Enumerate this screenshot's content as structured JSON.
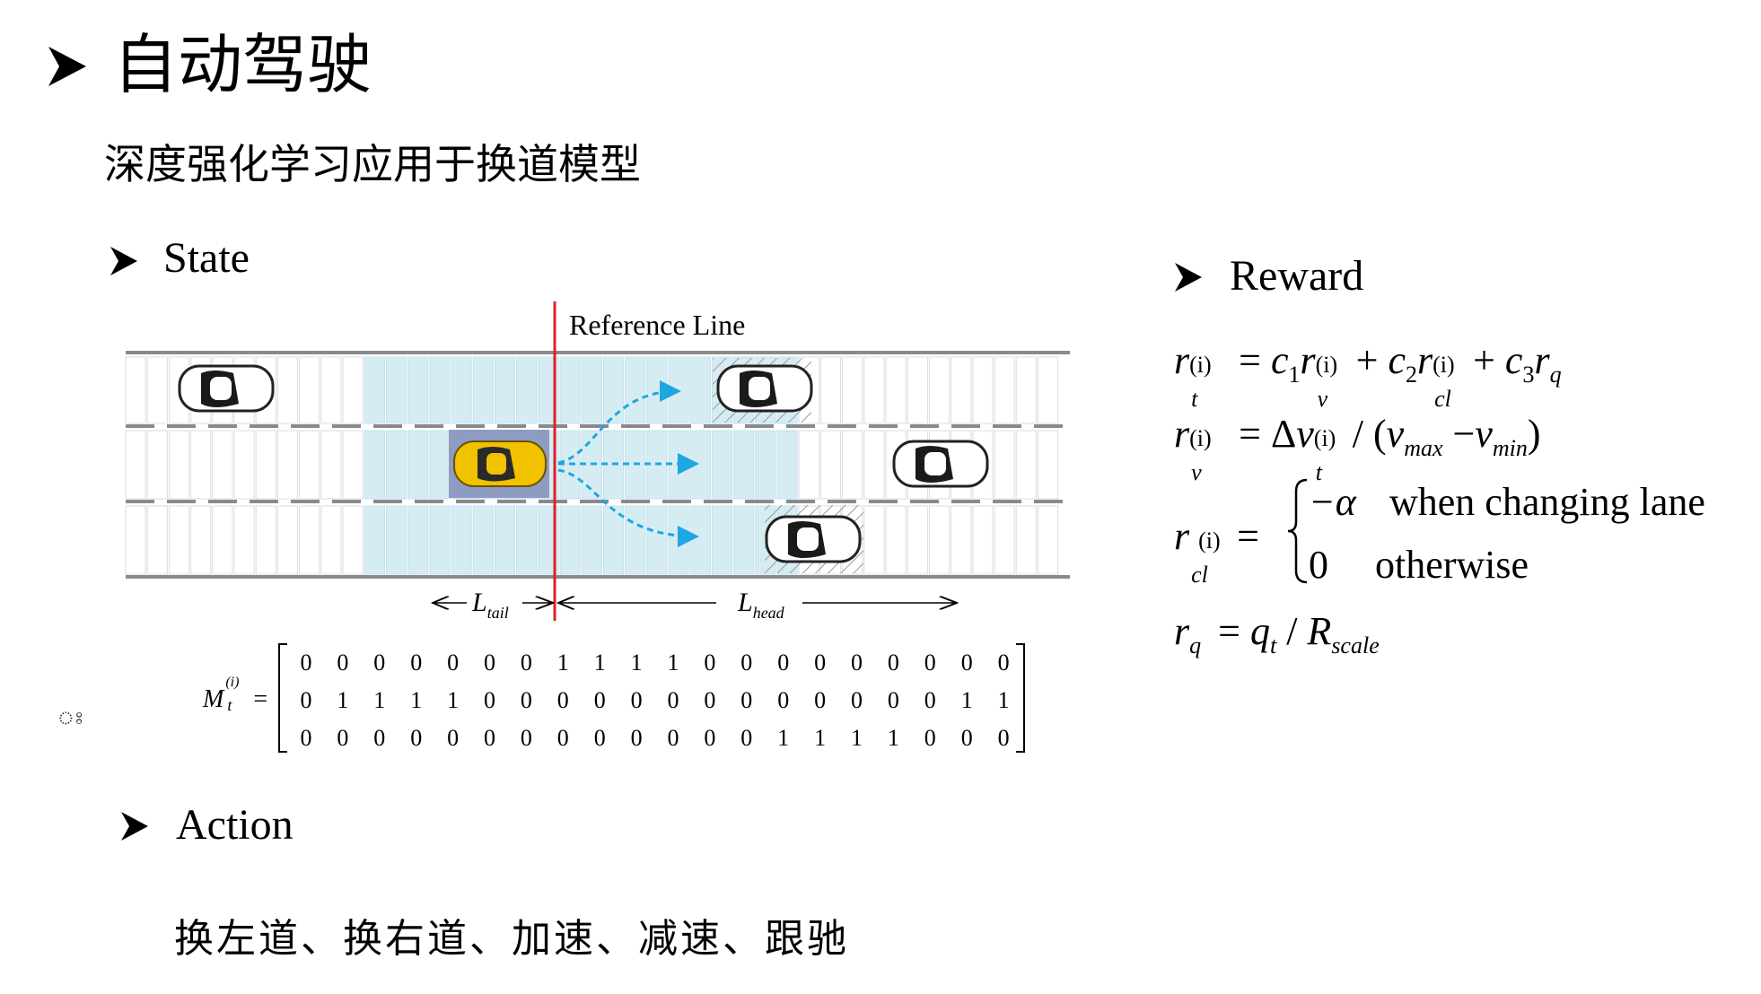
{
  "slide": {
    "title": "自动驾驶",
    "subtitle": "深度强化学习应用于换道模型"
  },
  "sections": {
    "state": "State",
    "reward": "Reward",
    "action": "Action"
  },
  "action_text": "换左道、换右道、加速、减速、跟驰",
  "figure": {
    "reference_line_label": "Reference Line",
    "l_tail": {
      "base": "L",
      "sub": "tail"
    },
    "l_head": {
      "base": "L",
      "sub": "head"
    },
    "ego_color": "#f2c200",
    "highlight_color": "#d6ecf3",
    "reference_color": "#e0202a",
    "arrow_color": "#1ea7e1"
  },
  "matrix": {
    "symbol": "M",
    "sub": "t",
    "sup": "(i)",
    "equals": "=",
    "rows": [
      [
        "0",
        "0",
        "0",
        "0",
        "0",
        "0",
        "0",
        "1",
        "1",
        "1",
        "1",
        "0",
        "0",
        "0",
        "0",
        "0",
        "0",
        "0",
        "0",
        "0"
      ],
      [
        "0",
        "1",
        "1",
        "1",
        "1",
        "0",
        "0",
        "0",
        "0",
        "0",
        "0",
        "0",
        "0",
        "0",
        "0",
        "0",
        "0",
        "0",
        "1",
        "1"
      ],
      [
        "0",
        "0",
        "0",
        "0",
        "0",
        "0",
        "0",
        "0",
        "0",
        "0",
        "0",
        "0",
        "0",
        "1",
        "1",
        "1",
        "1",
        "0",
        "0",
        "0"
      ]
    ]
  },
  "stray_mark": "ঃ",
  "reward_formulas": {
    "f1": {
      "lhs": "r",
      "lhs_sub": "t",
      "lhs_sup": "(i)",
      "rhs": [
        "c",
        "1",
        "r",
        "v",
        "(i)",
        "c",
        "2",
        "r",
        "cl",
        "(i)",
        "c",
        "3",
        "r",
        "q"
      ]
    },
    "f2": {
      "lhs": "r",
      "lhs_sub": "v",
      "lhs_sup": "(i)",
      "delta": "Δ",
      "v": "v",
      "v_sub": "t",
      "v_sup": "(i)",
      "vmax_sub": "max",
      "vmin_sub": "min"
    },
    "f3": {
      "lhs": "r",
      "lhs_sub": "cl",
      "lhs_sup": "(i)",
      "case1_value": "−α",
      "case1_text": "when changing lane",
      "case2_value": "0",
      "case2_text": "otherwise"
    },
    "f4": {
      "lhs": "r",
      "lhs_sub": "q",
      "q": "q",
      "q_sub": "t",
      "R": "R",
      "R_sub": "scale"
    }
  }
}
